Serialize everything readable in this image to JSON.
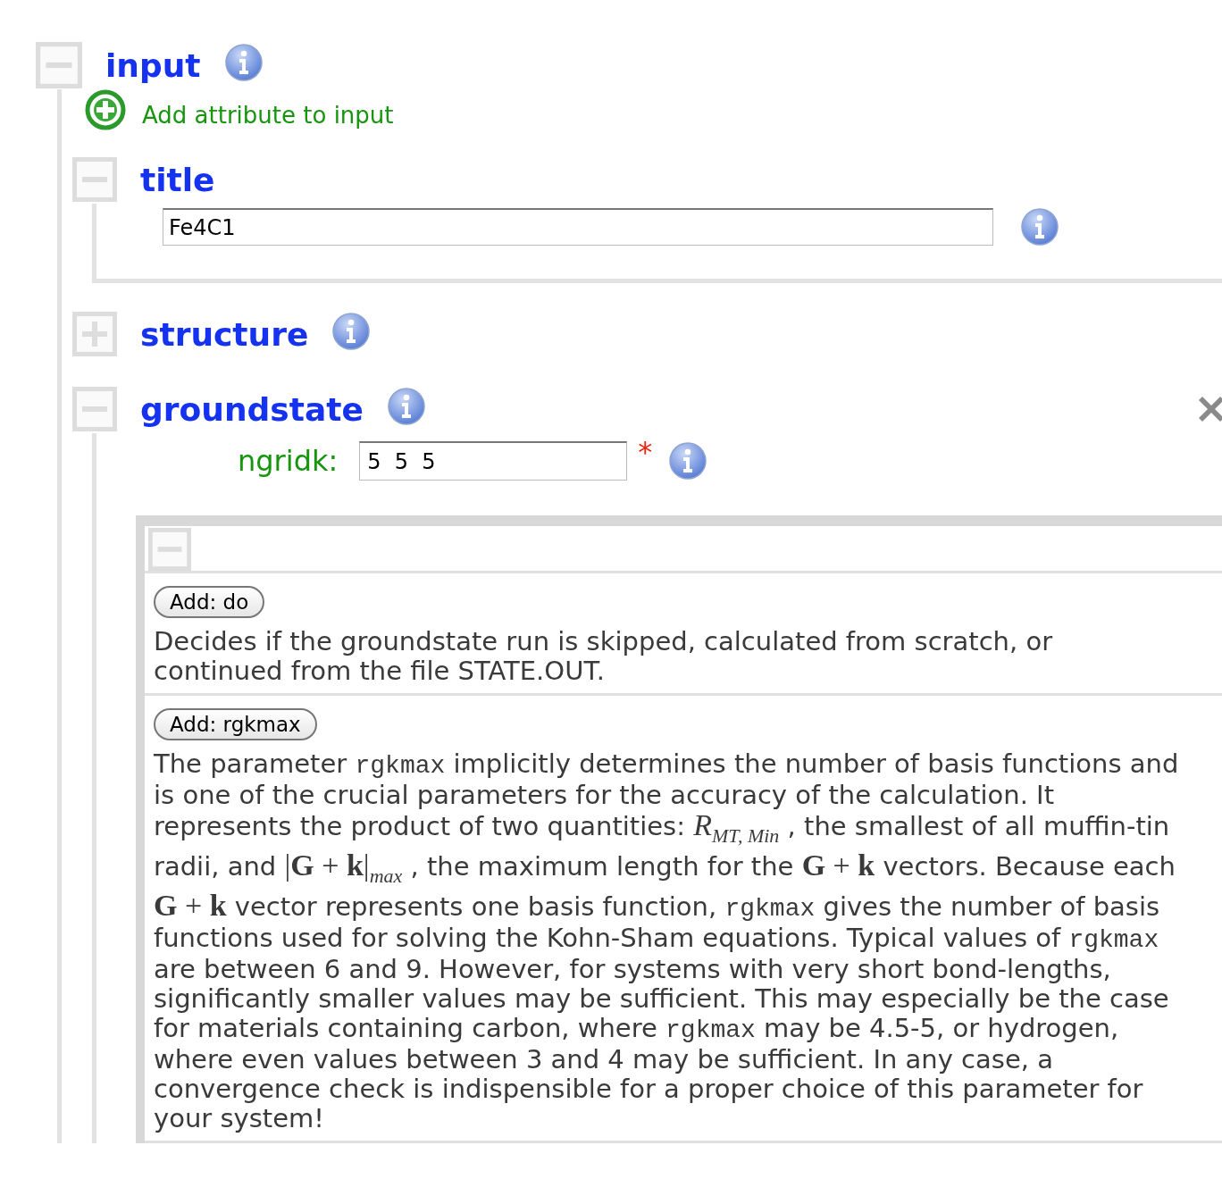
{
  "tree": {
    "label": "input",
    "expanded": true,
    "add_attribute": "Add attribute to input",
    "children": [
      {
        "kind": "field",
        "label": "title",
        "expanded": true,
        "value": "Fe4C1"
      },
      {
        "kind": "collapsed",
        "label": "structure",
        "expanded": false
      },
      {
        "kind": "panel",
        "label": "groundstate",
        "expanded": true,
        "attributes": [
          {
            "label": "ngridk:",
            "value": "5  5  5",
            "required_mark": "*"
          }
        ],
        "panel": {
          "expanded": true,
          "sections": [
            {
              "button": "Add: do",
              "description": [
                {
                  "kind": "text",
                  "text": "Decides if the groundstate run is skipped, calculated from scratch, or continued from the file STATE.OUT."
                }
              ]
            },
            {
              "button": "Add: rgkmax",
              "description": [
                {
                  "kind": "text",
                  "text": "The parameter "
                },
                {
                  "kind": "code",
                  "text": "rgkmax"
                },
                {
                  "kind": "text",
                  "text": " implicitly determines the number of basis functions and is one of the crucial parameters for the accuracy of the calculation. It represents the product of two quantities: "
                },
                {
                  "kind": "math",
                  "text": "*R*$_{MT, Min}$"
                },
                {
                  "kind": "text",
                  "text": " , the smallest of all muffin-tin radii, and "
                },
                {
                  "kind": "math",
                  "text": "|**G** + **k**|$_{max}$"
                },
                {
                  "kind": "text",
                  "text": " , the maximum length for the "
                },
                {
                  "kind": "math",
                  "text": "**G** + **k**"
                },
                {
                  "kind": "text",
                  "text": " vectors. Because each "
                },
                {
                  "kind": "math",
                  "text": "**G** + **k**"
                },
                {
                  "kind": "text",
                  "text": " vector represents one basis function, "
                },
                {
                  "kind": "code",
                  "text": "rgkmax"
                },
                {
                  "kind": "text",
                  "text": " gives the number of basis functions used for solving the Kohn-Sham equations. Typical values of "
                },
                {
                  "kind": "code",
                  "text": "rgkmax"
                },
                {
                  "kind": "text",
                  "text": " are between 6 and 9. However, for systems with very short bond-lengths, significantly smaller values may be sufficient. This may especially be the case for materials containing carbon, where "
                },
                {
                  "kind": "code",
                  "text": "rgkmax"
                },
                {
                  "kind": "text",
                  "text": " may be 4.5-5, or hydrogen, where even values between 3 and 4 may be sufficient. In any case, a convergence check is indispensible for a proper choice of this parameter for your system!"
                }
              ]
            }
          ]
        }
      }
    ]
  }
}
